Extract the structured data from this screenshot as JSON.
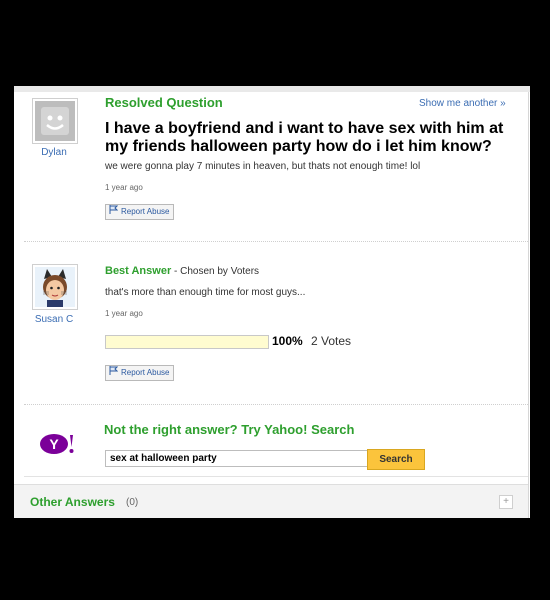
{
  "question": {
    "heading": "Resolved Question",
    "show_another": "Show me another »",
    "title": "I have a boyfriend and i want to have sex with him at my friends halloween party how do i let him know?",
    "details": "we were gonna play 7 minutes in heaven, but thats not enough time! lol",
    "time": "1 year ago",
    "report": "Report Abuse",
    "author": "Dylan"
  },
  "best_answer": {
    "heading": "Best Answer",
    "chosen_by": " - Chosen by Voters",
    "text": "that's more than enough time for most guys...",
    "time": "1 year ago",
    "report": "Report Abuse",
    "author": "Susan C",
    "vote_percent": "100%",
    "votes": "2 Votes",
    "vote_fraction": 1.0
  },
  "search": {
    "prompt": "Not the right answer? Try Yahoo! Search",
    "query": "sex at halloween party",
    "button": "Search"
  },
  "other_answers": {
    "title": "Other Answers",
    "count": "(0)"
  },
  "colors": {
    "green": "#2e9f2e",
    "link": "#3b6db3",
    "yahoo_purple": "#7b0099",
    "search_button": "#fbc43c"
  }
}
